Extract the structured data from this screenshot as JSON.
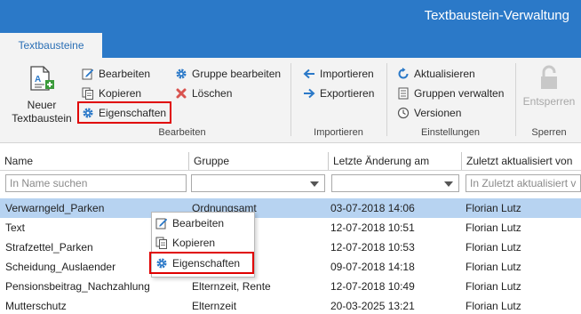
{
  "window": {
    "title": "Textbaustein-Verwaltung"
  },
  "ribbon": {
    "tab": "Textbausteine",
    "new_button": {
      "line1": "Neuer",
      "line2": "Textbaustein"
    },
    "bearbeiten_group": {
      "edit": "Bearbeiten",
      "copy": "Kopieren",
      "properties": "Eigenschaften",
      "edit_group": "Gruppe bearbeiten",
      "delete": "Löschen",
      "label": "Bearbeiten"
    },
    "importieren_group": {
      "import": "Importieren",
      "export": "Exportieren",
      "label": "Importieren"
    },
    "einstellungen_group": {
      "refresh": "Aktualisieren",
      "manage_groups": "Gruppen verwalten",
      "versions": "Versionen",
      "label": "Einstellungen"
    },
    "sperren_group": {
      "unlock": "Entsperren",
      "label": "Sperren"
    }
  },
  "table": {
    "columns": [
      "Name",
      "Gruppe",
      "Letzte Änderung am",
      "Zuletzt aktualisiert von"
    ],
    "filters": {
      "name_placeholder": "In Name suchen",
      "user_placeholder": "In Zuletzt aktualisiert von suchen"
    },
    "rows": [
      {
        "name": "Verwarngeld_Parken",
        "group": "Ordnungsamt",
        "date": "03-07-2018 14:06",
        "user": "Florian Lutz"
      },
      {
        "name": "Text",
        "group": "",
        "date": "12-07-2018 10:51",
        "user": "Florian Lutz"
      },
      {
        "name": "Strafzettel_Parken",
        "group": "",
        "date": "12-07-2018 10:53",
        "user": "Florian Lutz"
      },
      {
        "name": "Scheidung_Auslaender",
        "group": "",
        "date": "09-07-2018 14:18",
        "user": "Florian Lutz"
      },
      {
        "name": "Pensionsbeitrag_Nachzahlung",
        "group": "Elternzeit, Rente",
        "date": "12-07-2018 10:49",
        "user": "Florian Lutz"
      },
      {
        "name": "Mutterschutz",
        "group": "Elternzeit",
        "date": "20-03-2025 13:21",
        "user": "Florian Lutz"
      }
    ]
  },
  "context_menu": {
    "items": [
      "Bearbeiten",
      "Kopieren",
      "Eigenschaften"
    ]
  },
  "colors": {
    "accent": "#2b79c8",
    "selection": "#b7d3f1",
    "highlight": "#e00000",
    "delete": "#d9534f"
  }
}
